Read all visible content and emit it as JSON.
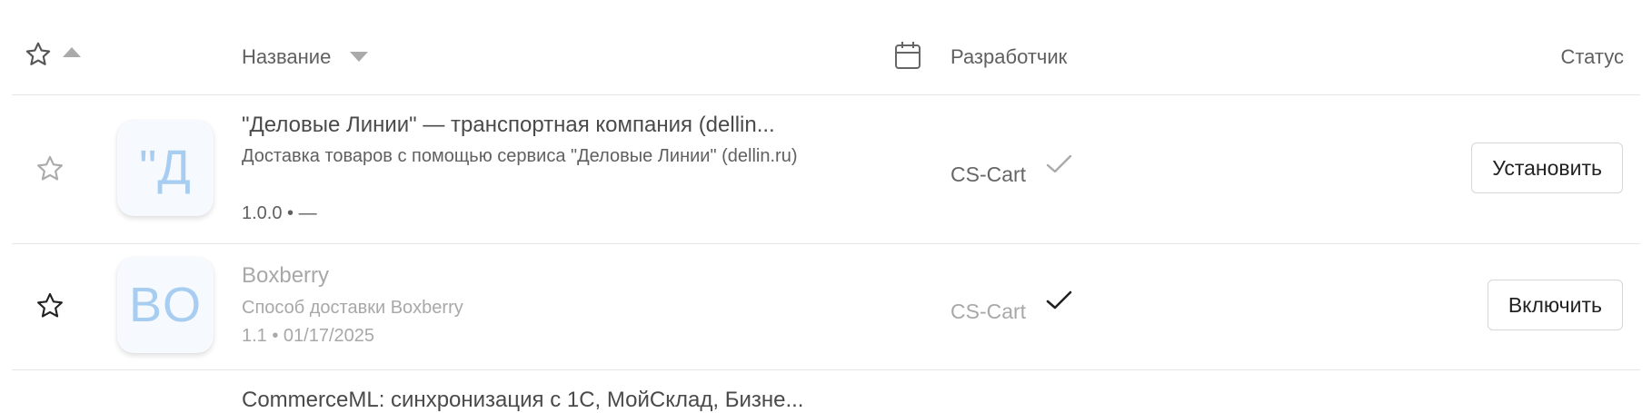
{
  "header": {
    "name_label": "Название",
    "developer_label": "Разработчик",
    "status_label": "Статус"
  },
  "rows": [
    {
      "icon_text": "\"Д",
      "title": "\"Деловые Линии\" — транспортная компания (dellin...",
      "description": "Доставка товаров с помощью сервиса \"Деловые Линии\" (dellin.ru)",
      "meta": "1.0.0 • —",
      "developer": "CS-Cart",
      "action_label": "Установить"
    },
    {
      "icon_text": "BO",
      "title": "Boxberry",
      "description": "Способ доставки Boxberry",
      "meta": "1.1 • 01/17/2025",
      "developer": "CS-Cart",
      "action_label": "Включить"
    },
    {
      "title": "CommerceML: синхронизация с 1С, МойСклад, Бизне..."
    }
  ]
}
